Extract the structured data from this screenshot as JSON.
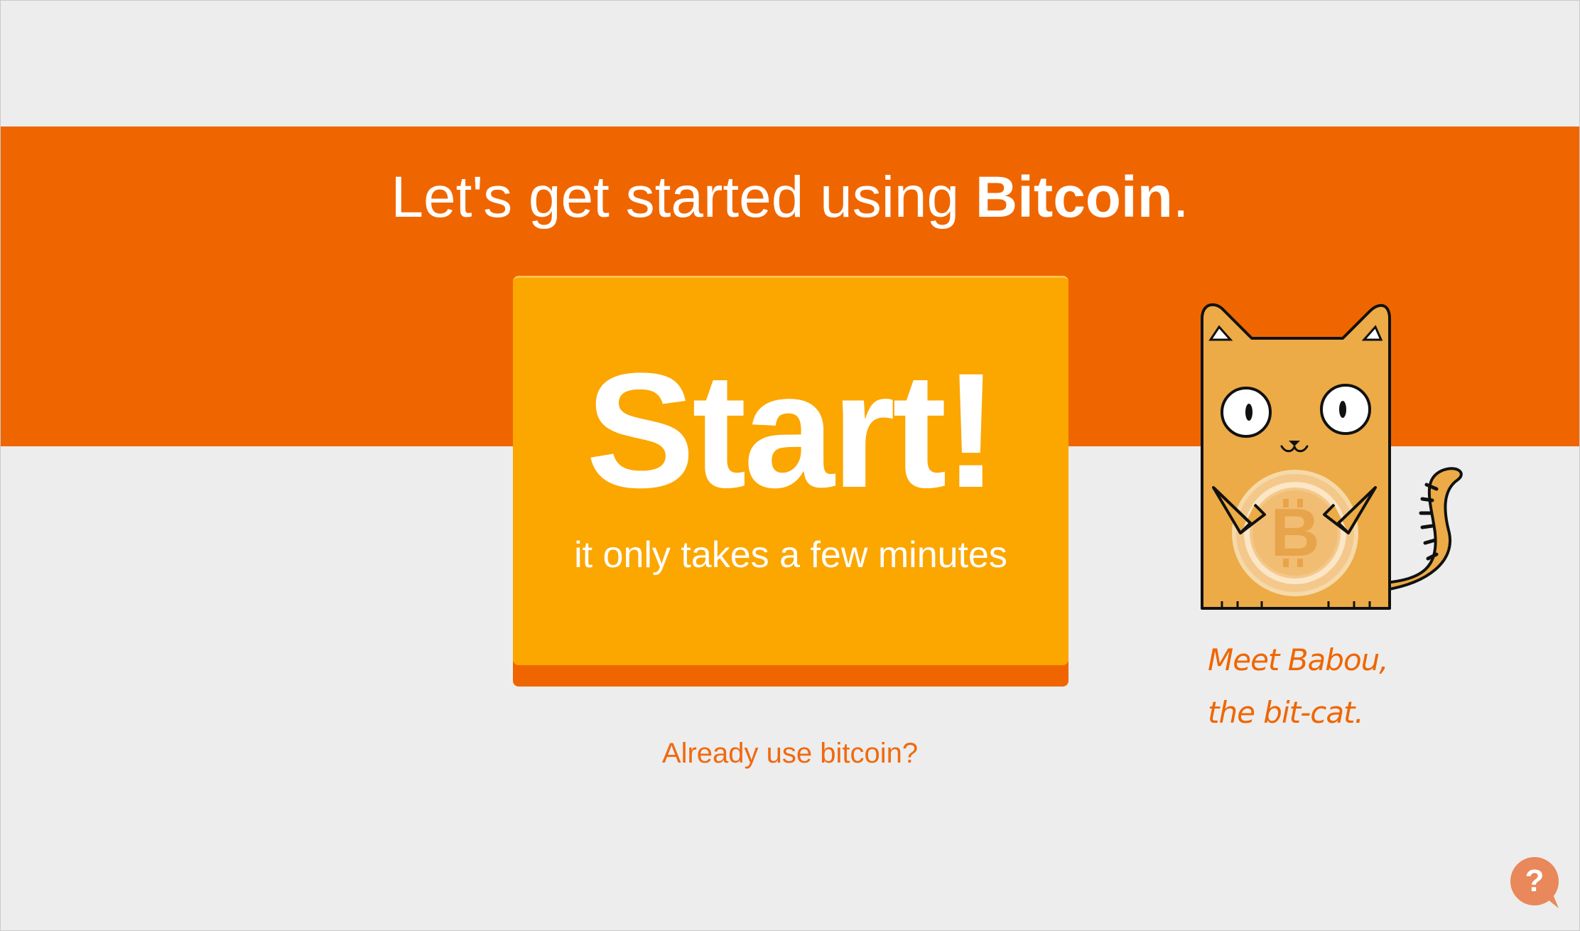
{
  "header": {
    "headline_prefix": "Let's get started using ",
    "headline_brand": "Bitcoin",
    "headline_suffix": "."
  },
  "start_button": {
    "label": "Start!",
    "subtitle": "it only takes a few minutes"
  },
  "links": {
    "already_use": "Already use bitcoin?"
  },
  "mascot": {
    "caption_line1": "Meet Babou,",
    "caption_line2": "the bit-cat."
  },
  "help": {
    "icon": "question-mark-icon"
  },
  "colors": {
    "banner": "#ef6600",
    "button": "#fca600",
    "background": "#ededed",
    "link": "#ef6a10",
    "cat_body": "#ecab46"
  }
}
